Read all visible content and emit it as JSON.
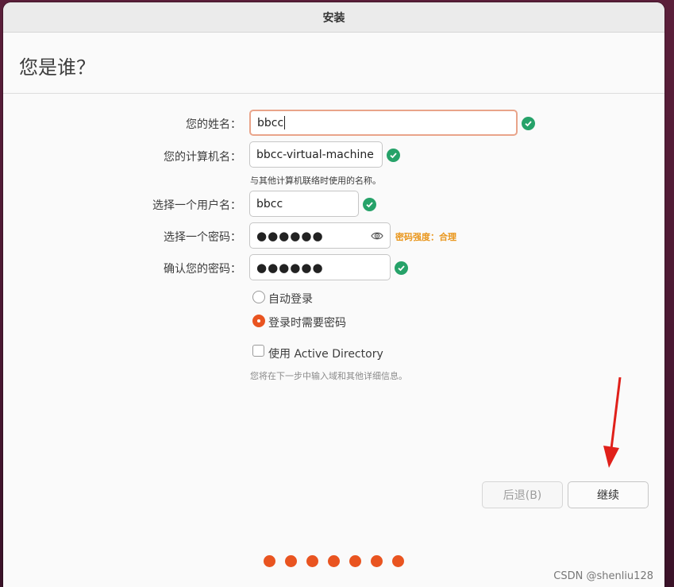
{
  "window": {
    "title": "安装"
  },
  "page": {
    "heading": "您是谁？"
  },
  "form": {
    "name_label": "您的姓名：",
    "name_value": "bbcc",
    "computer_label": "您的计算机名：",
    "computer_value": "bbcc-virtual-machine",
    "computer_hint": "与其他计算机联络时使用的名称。",
    "username_label": "选择一个用户名：",
    "username_value": "bbcc",
    "password_label": "选择一个密码：",
    "password_value": "●●●●●●",
    "password_strength": "密码强度：合理",
    "confirm_label": "确认您的密码：",
    "confirm_value": "●●●●●●"
  },
  "options": {
    "auto_login": "自动登录",
    "require_password": "登录时需要密码",
    "selected": "require_password",
    "active_directory": "使用 Active Directory",
    "active_directory_checked": false,
    "ad_note": "您将在下一步中输入域和其他详细信息。"
  },
  "buttons": {
    "back": "后退(B)",
    "continue": "继续"
  },
  "progress": {
    "total_steps": 7
  },
  "colors": {
    "accent": "#e95420",
    "valid": "#26a269",
    "strength": "#e9961c",
    "annotation_arrow": "#e0201a"
  },
  "icons": {
    "valid": "check-circle-icon",
    "reveal": "eye-icon"
  },
  "watermark": "CSDN @shenliu128"
}
